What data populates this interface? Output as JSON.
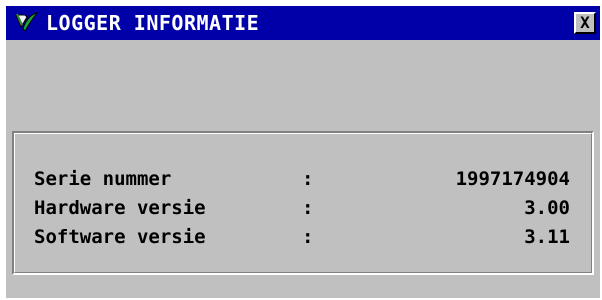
{
  "window": {
    "title": "LOGGER INFORMATIE",
    "icon": "logger-app-icon",
    "close_label": "X"
  },
  "info": {
    "rows": [
      {
        "label": "Serie nummer",
        "separator": ":",
        "value": "1997174904"
      },
      {
        "label": "Hardware versie",
        "separator": ":",
        "value": "3.00"
      },
      {
        "label": "Software versie",
        "separator": ":",
        "value": "3.11"
      }
    ]
  },
  "colors": {
    "titlebar": "#0000a8",
    "window_bg": "#c0c0c0",
    "title_text": "#ffffff"
  }
}
